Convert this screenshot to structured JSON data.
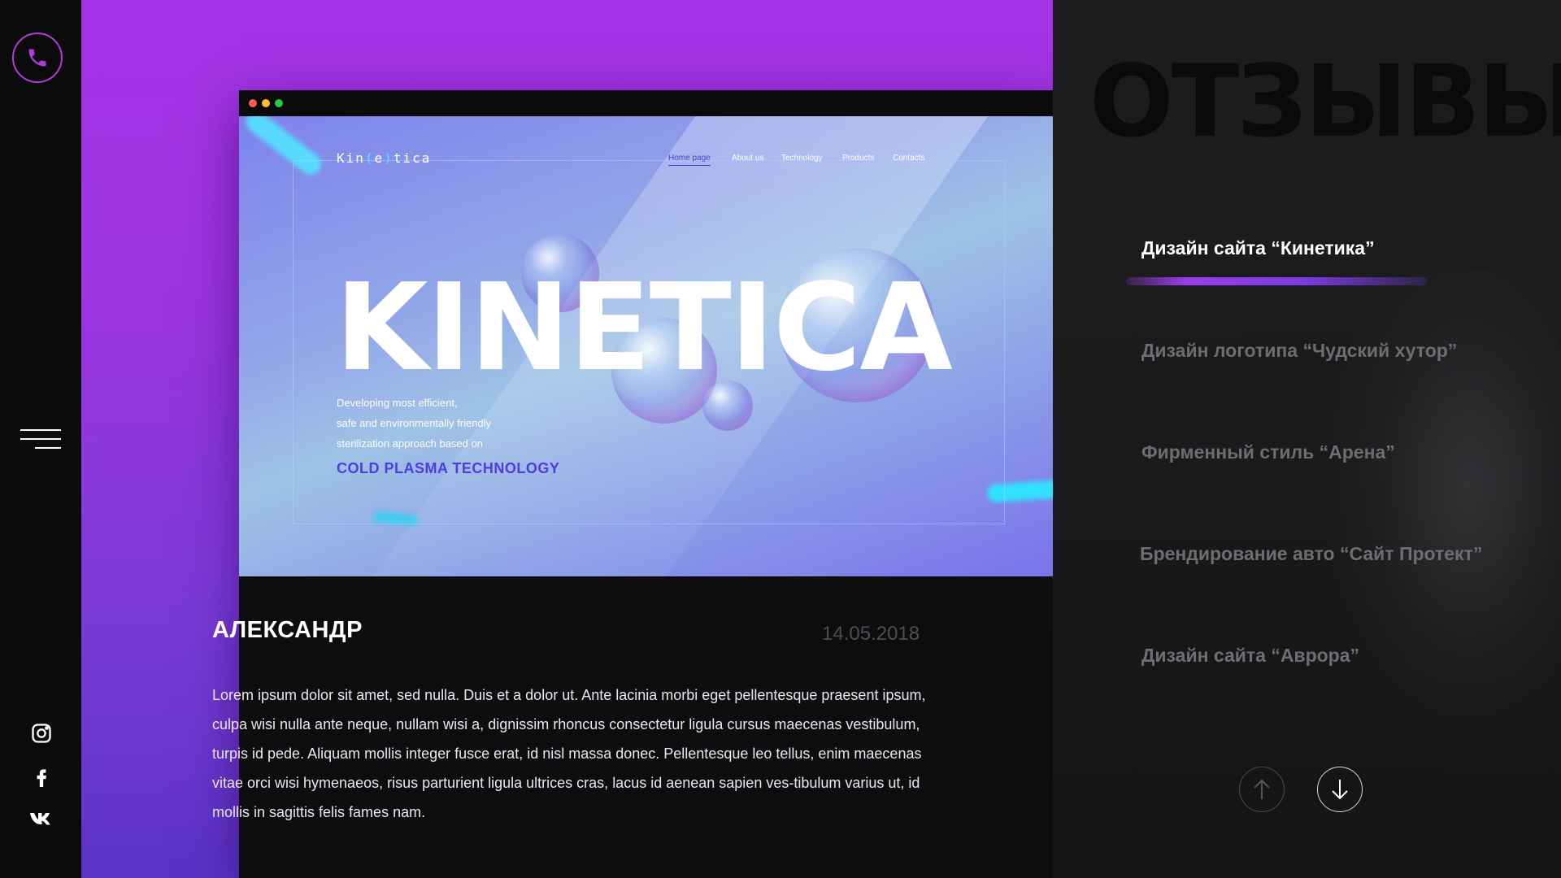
{
  "sidebar": {
    "phone_icon": "phone-icon",
    "menu_icon": "hamburger-icon",
    "socials": [
      {
        "icon": "instagram-icon"
      },
      {
        "icon": "facebook-icon"
      },
      {
        "icon": "vk-icon"
      }
    ],
    "accent": "#b13be0"
  },
  "preview": {
    "logo_parts": [
      "Kin",
      "(",
      "e",
      ")",
      "tica"
    ],
    "nav": [
      "Home page",
      "About us",
      "Technology",
      "Products",
      "Contacts"
    ],
    "active_nav": "Home page",
    "headline": "KINETICA",
    "subtitle_lines": [
      "Developing most efficient,",
      "safe and environmentally friendly",
      "sterilization approach based on"
    ],
    "accent_line": "COLD PLASMA TECHNOLOGY"
  },
  "review": {
    "name": "АЛЕКСАНДР",
    "date": "14.05.2018",
    "text": "Lorem ipsum dolor sit amet, sed nulla. Duis et a dolor ut. Ante lacinia morbi eget pellentesque praesent ipsum, culpa wisi nulla ante neque, nullam wisi a, dignissim rhoncus consectetur ligula cursus maecenas vestibulum, turpis id pede. Aliquam mollis integer fusce erat, id nisl massa donec. Pellentesque leo tellus, enim maecenas vitae orci wisi hymenaeos, risus parturient ligula ultrices cras, lacus id aenean sapien ves-tibulum varius ut, id mollis in sagittis felis fames nam."
  },
  "panel": {
    "title": "ОТЗЫВЫ",
    "items": [
      {
        "label": "Дизайн сайта “Кинетика”",
        "active": true
      },
      {
        "label": "Дизайн логотипа “Чудский хутор”",
        "active": false
      },
      {
        "label": "Фирменный стиль  “Арена”",
        "active": false
      },
      {
        "label": "Брендирование авто “Сайт Протект”",
        "active": false
      },
      {
        "label": "Дизайн сайта “Аврора”",
        "active": false
      }
    ],
    "up_icon": "arrow-up-icon",
    "down_icon": "arrow-down-icon"
  }
}
